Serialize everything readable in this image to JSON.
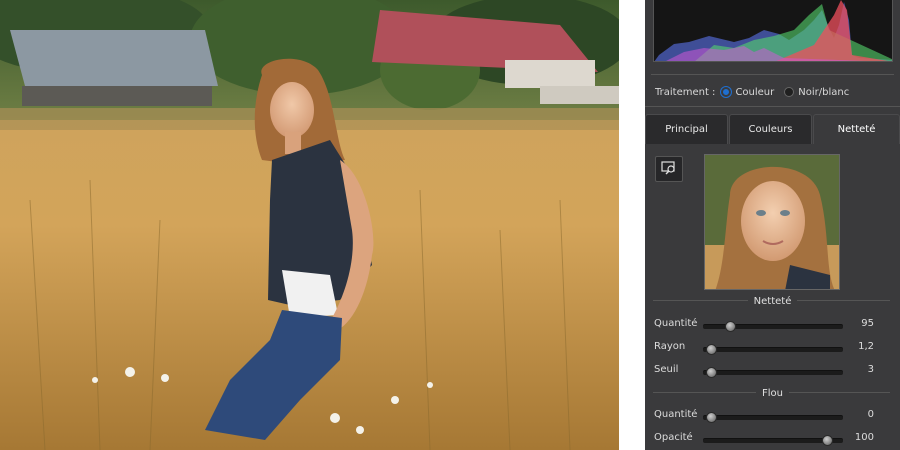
{
  "processing": {
    "label": "Traitement :",
    "option_color": "Couleur",
    "option_bw": "Noir/blanc",
    "selected": "Couleur"
  },
  "tabs": [
    {
      "label": "Principal",
      "active": false
    },
    {
      "label": "Couleurs",
      "active": false
    },
    {
      "label": "Netteté",
      "active": true
    }
  ],
  "sharpness": {
    "title": "Netteté",
    "sliders": [
      {
        "label": "Quantité",
        "value": "95",
        "fraction": 0.16
      },
      {
        "label": "Rayon",
        "value": "1,2",
        "fraction": 0.0
      },
      {
        "label": "Seuil",
        "value": "3",
        "fraction": 0.0
      }
    ]
  },
  "blur": {
    "title": "Flou",
    "sliders": [
      {
        "label": "Quantité",
        "value": "0",
        "fraction": 0.0
      },
      {
        "label": "Opacité",
        "value": "100",
        "fraction": 1.0
      }
    ]
  },
  "icons": {
    "picker": "sample-picker-icon"
  },
  "colors": {
    "panel_bg": "#3a3a3c",
    "accent": "#1f6fd0"
  }
}
